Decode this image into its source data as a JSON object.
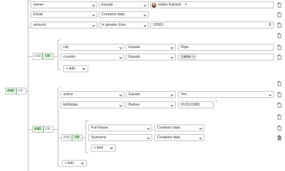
{
  "rules": [
    {
      "field": "owner",
      "operator": "Equals",
      "value": "Valdis Kalniņš"
    },
    {
      "field": "Email",
      "operator": "Contains data",
      "value": ""
    },
    {
      "field": "amount",
      "operator": "Is greater than",
      "value": "10000",
      "suffix": "$"
    }
  ],
  "group1": {
    "and": "AND",
    "or": "OR",
    "active": "OR",
    "rules": [
      {
        "field": "city",
        "operator": "Equals",
        "value": "Riga"
      },
      {
        "field": "country",
        "operator": "Equals",
        "value": "Latvia"
      }
    ],
    "add_label": "+ Add"
  },
  "root": {
    "and": "AND",
    "or": "OR",
    "active": "AND"
  },
  "group2": {
    "and": "AND",
    "or": "OR",
    "active": "AND",
    "rules": [
      {
        "field": "active",
        "operator": "Equals",
        "value": "Yes"
      },
      {
        "field": "birthdate",
        "operator": "Before",
        "value": "01/01/1980",
        "marker": "*"
      }
    ],
    "nested": {
      "and": "AND",
      "or": "OR",
      "active": "OR",
      "rules": [
        {
          "field": "Full Name",
          "operator": "Contains data"
        },
        {
          "field": "Surname",
          "operator": "Contains data"
        }
      ],
      "add_label": "+ Add"
    },
    "add_label": "+ Add"
  },
  "icons": {
    "trash": "trash-icon",
    "close": "close-icon",
    "dropdown": "chevron-down-icon"
  },
  "colors": {
    "accent_green": "#2e7d32",
    "active_bg": "#e8f6e9",
    "border": "#c4c4c4",
    "line": "#bdbdbd"
  }
}
